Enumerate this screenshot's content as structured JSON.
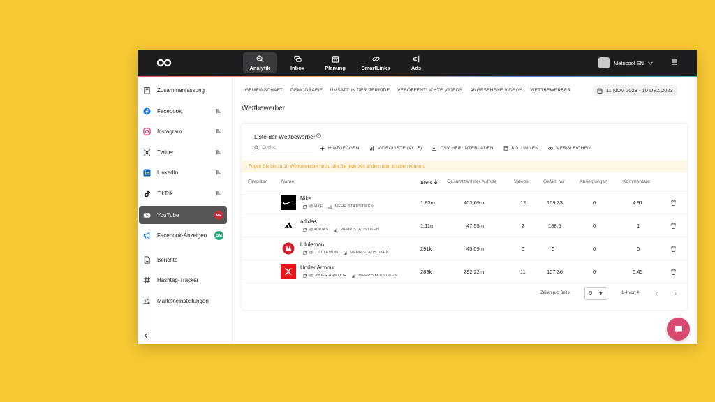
{
  "topbar": {
    "nav": [
      {
        "label": "Analytik",
        "icon": "analytics-icon"
      },
      {
        "label": "Inbox",
        "icon": "inbox-icon"
      },
      {
        "label": "Planung",
        "icon": "calendar-icon"
      },
      {
        "label": "SmartLinks",
        "icon": "link-icon"
      },
      {
        "label": "Ads",
        "icon": "megaphone-icon"
      }
    ],
    "account_name": "Metricool EN"
  },
  "sidebar": {
    "items": [
      {
        "label": "Zusammenfassung",
        "icon": "summary-icon"
      },
      {
        "label": "Facebook",
        "icon": "facebook-icon"
      },
      {
        "label": "Instagram",
        "icon": "instagram-icon"
      },
      {
        "label": "Twitter",
        "icon": "x-twitter-icon"
      },
      {
        "label": "LinkedIn",
        "icon": "linkedin-icon"
      },
      {
        "label": "TikTok",
        "icon": "tiktok-icon"
      },
      {
        "label": "YouTube",
        "icon": "youtube-icon",
        "badge": "ME"
      },
      {
        "label": "Facebook-Anzeigen",
        "icon": "facebook-ads-icon",
        "badge": "BM"
      },
      {
        "label": "Berichte",
        "icon": "report-icon"
      },
      {
        "label": "Hashtag-Tracker",
        "icon": "hashtag-icon"
      },
      {
        "label": "Markeneinstellungen",
        "icon": "settings-sliders-icon"
      }
    ]
  },
  "tabs": [
    "GEMEINSCHAFT",
    "DEMOGRAFIE",
    "UMSATZ IN DER PERIODE",
    "VERÖFFENTLICHTE VIDEOS",
    "ANGESEHENE VIDEOS",
    "WETTBEWERBER"
  ],
  "date_range": "11 NOV 2023 - 10 DEZ 2023",
  "section_title": "Wettbewerber",
  "card": {
    "title": "Liste der Wettbewerber",
    "search_placeholder": "Suche",
    "tools": [
      "HINZUFÜGEN",
      "VIDEOLISTE (ALLE)",
      "CSV HERUNTERLADEN",
      "KOLUMNEN",
      "VERGLEICHEN"
    ],
    "notice": "Fügen Sie bis zu 10 Wettbewerber hinzu, die Sie jederzeit ändern oder löschen können.",
    "columns": [
      "Favoriten",
      "Name",
      "Abos",
      "Gesamtzahl der Aufrufe",
      "Videos",
      "Gefällt mir",
      "Abneigungen",
      "Kommentare"
    ],
    "more_stats_label": "MEHR STATISTIKEN",
    "rows": [
      {
        "name": "Nike",
        "handle": "@NIKE",
        "abos": "1.83m",
        "views": "403.69m",
        "videos": "12",
        "likes": "169.33",
        "dislikes": "0",
        "comments": "4.91",
        "logo_color": "#000000"
      },
      {
        "name": "adidas",
        "handle": "@ADIDAS",
        "abos": "1.11m",
        "views": "47.55m",
        "videos": "2",
        "likes": "188.5",
        "dislikes": "0",
        "comments": "1",
        "logo_color": "#000000"
      },
      {
        "name": "lululemon",
        "handle": "@LULULEMON",
        "abos": "291k",
        "views": "45.09m",
        "videos": "0",
        "likes": "0",
        "dislikes": "0",
        "comments": "0",
        "logo_color": "#d22030"
      },
      {
        "name": "Under Armour",
        "handle": "@UNDER ARMOUR",
        "abos": "289k",
        "views": "292.22m",
        "videos": "11",
        "likes": "107.36",
        "dislikes": "0",
        "comments": "0.45",
        "logo_color": "#e8141c"
      }
    ],
    "footer": {
      "per_page_label": "Zeilen pro Seite:",
      "per_page_value": "5",
      "range": "1-4 von 4"
    }
  },
  "colors": {
    "background": "#F7C833",
    "topbar": "#1d1d1f",
    "active_sidebar": "#555555",
    "notice_text": "#e8a43a",
    "chat_button": "#d84a72"
  }
}
